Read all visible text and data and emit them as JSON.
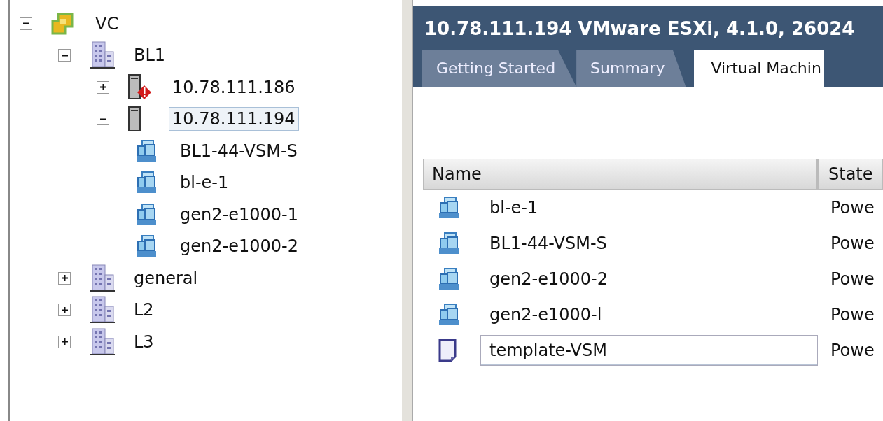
{
  "tree": [
    {
      "label": "VC",
      "kind": "vcenter",
      "expanded": true,
      "selected": false,
      "children": [
        {
          "label": "BL1",
          "kind": "datacenter",
          "expanded": true,
          "selected": false,
          "children": [
            {
              "label": "10.78.111.186",
              "kind": "host",
              "alert": true,
              "expanded": false,
              "selected": false
            },
            {
              "label": "10.78.111.194",
              "kind": "host",
              "alert": false,
              "expanded": true,
              "selected": true,
              "children": [
                {
                  "label": "BL1-44-VSM-S",
                  "kind": "vm",
                  "selected": false
                },
                {
                  "label": "bl-e-1",
                  "kind": "vm",
                  "selected": false
                },
                {
                  "label": "gen2-e1000-1",
                  "kind": "vm",
                  "selected": false
                },
                {
                  "label": "gen2-e1000-2",
                  "kind": "vm",
                  "selected": false
                }
              ]
            }
          ]
        },
        {
          "label": "general",
          "kind": "datacenter",
          "expanded": false,
          "selected": false
        },
        {
          "label": "L2",
          "kind": "datacenter",
          "expanded": false,
          "selected": false
        },
        {
          "label": "L3",
          "kind": "datacenter",
          "expanded": false,
          "selected": false
        }
      ]
    }
  ],
  "header": {
    "title": "10.78.111.194 VMware ESXi, 4.1.0, 26024"
  },
  "tabs": [
    {
      "label": "Getting Started",
      "selected": false
    },
    {
      "label": "Summary",
      "selected": false
    },
    {
      "label": "Virtual Machin",
      "selected": true
    }
  ],
  "table": {
    "columns": [
      "Name",
      "State"
    ],
    "rows": [
      {
        "kind": "vm",
        "name": "bl-e-1",
        "state": "Powe",
        "selected": false
      },
      {
        "kind": "vm",
        "name": "BL1-44-VSM-S",
        "state": "Powe",
        "selected": false
      },
      {
        "kind": "vm",
        "name": "gen2-e1000-2",
        "state": "Powe",
        "selected": false
      },
      {
        "kind": "vm",
        "name": "gen2-e1000-l",
        "state": "Powe",
        "selected": false
      },
      {
        "kind": "template",
        "name": "template-VSM",
        "state": "Powe",
        "selected": true
      }
    ]
  }
}
